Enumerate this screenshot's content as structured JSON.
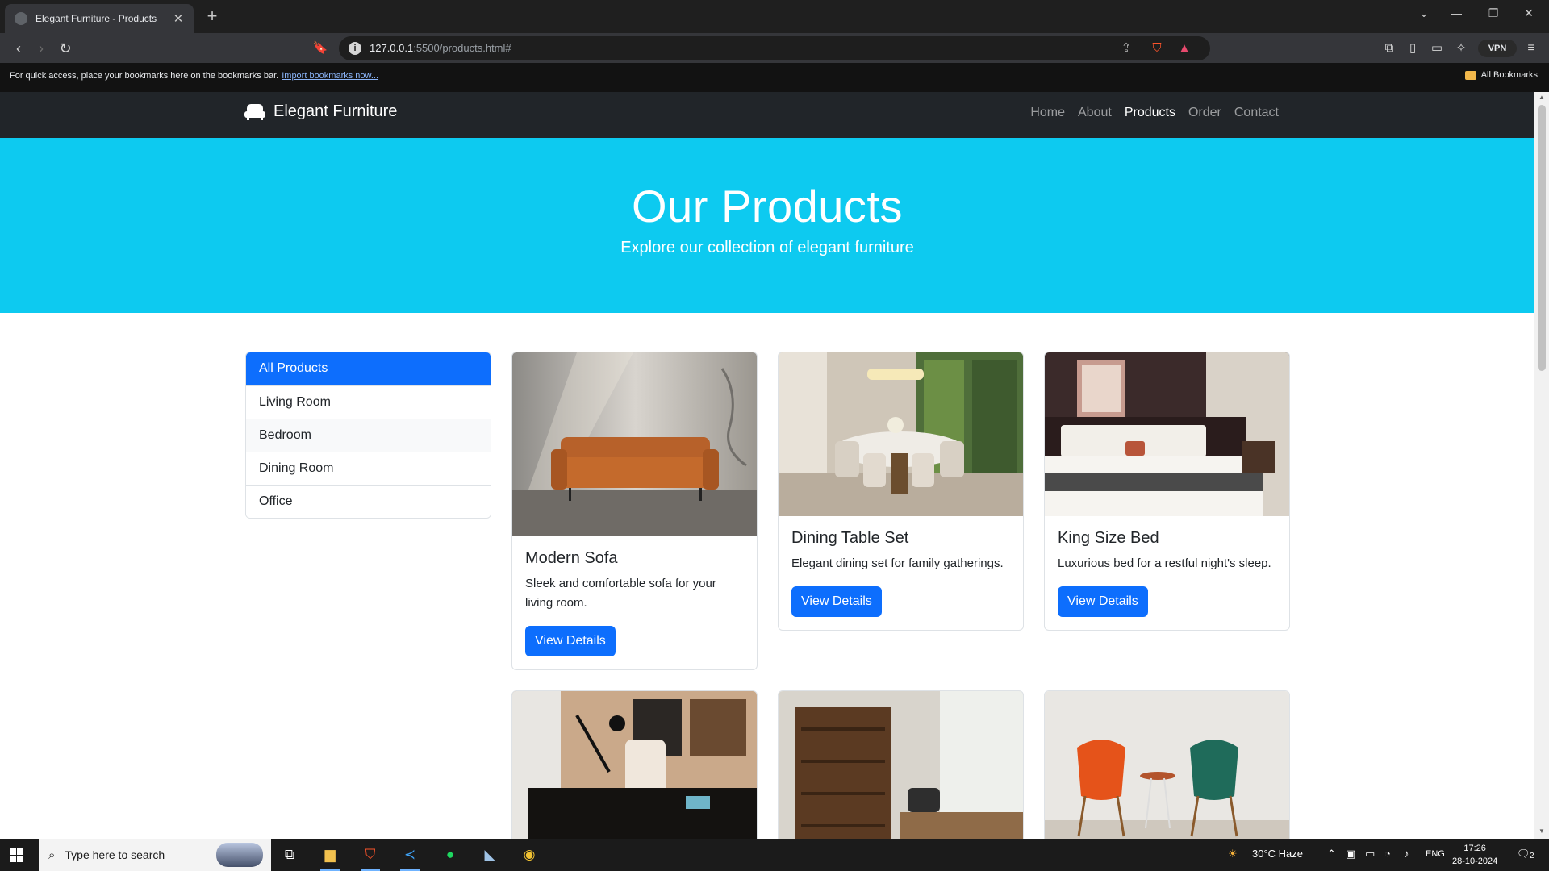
{
  "browser": {
    "tab_title": "Elegant Furniture - Products",
    "url_host": "127.0.0.1",
    "url_rest": ":5500/products.html#",
    "vpn_label": "VPN",
    "bookmarks_bar_text": "For quick access, place your bookmarks here on the bookmarks bar.",
    "bookmarks_import_link": "Import bookmarks now...",
    "all_bookmarks_label": "All Bookmarks"
  },
  "navbar": {
    "brand": "Elegant Furniture",
    "links": [
      {
        "label": "Home",
        "active": false
      },
      {
        "label": "About",
        "active": false
      },
      {
        "label": "Products",
        "active": true
      },
      {
        "label": "Order",
        "active": false
      },
      {
        "label": "Contact",
        "active": false
      }
    ]
  },
  "hero": {
    "title": "Our Products",
    "subtitle": "Explore our collection of elegant furniture"
  },
  "categories": [
    {
      "label": "All Products",
      "active": true
    },
    {
      "label": "Living Room",
      "active": false
    },
    {
      "label": "Bedroom",
      "active": false
    },
    {
      "label": "Dining Room",
      "active": false
    },
    {
      "label": "Office",
      "active": false
    }
  ],
  "products": [
    {
      "title": "Modern Sofa",
      "text": "Sleek and comfortable sofa for your living room.",
      "button": "View Details"
    },
    {
      "title": "Dining Table Set",
      "text": "Elegant dining set for family gatherings.",
      "button": "View Details"
    },
    {
      "title": "King Size Bed",
      "text": "Luxurious bed for a restful night's sleep.",
      "button": "View Details"
    }
  ],
  "taskbar": {
    "search_placeholder": "Type here to search",
    "weather": "30°C  Haze",
    "lang": "ENG",
    "time": "17:26",
    "date": "28-10-2024",
    "notification_count": "2"
  },
  "colors": {
    "hero_bg": "#0dcaf0",
    "primary": "#0d6efd",
    "navbar_bg": "#212529"
  }
}
